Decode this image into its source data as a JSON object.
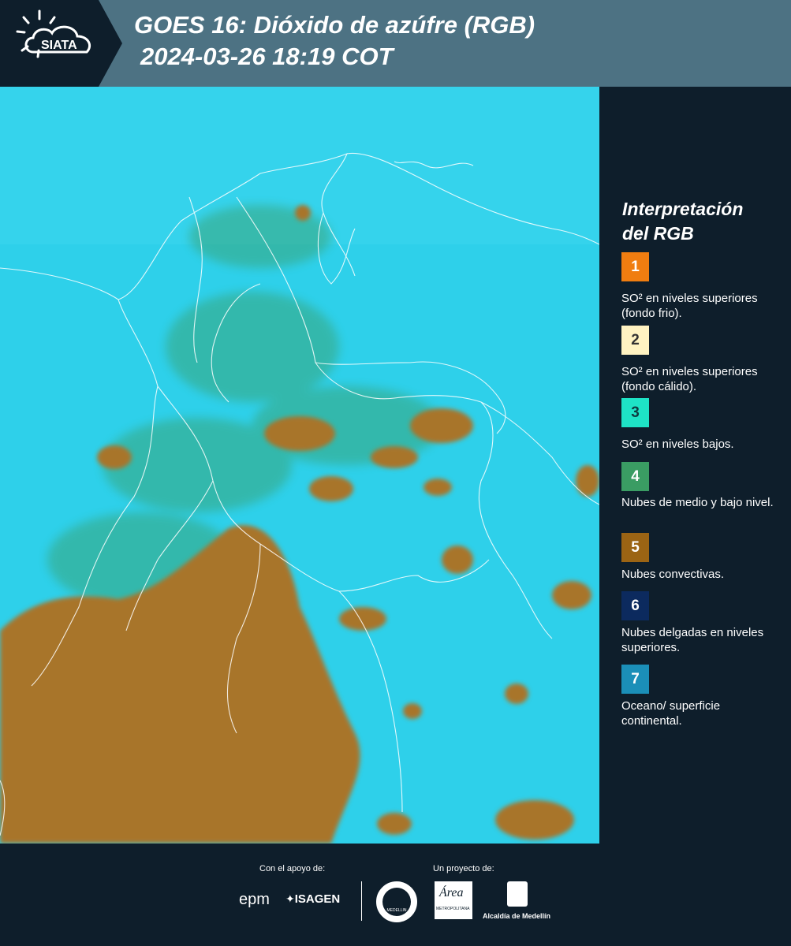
{
  "header": {
    "logo_text": "SIATA",
    "title_line1": "GOES 16: Dióxido de azúfre (RGB)",
    "title_line2": "2024-03-26 18:19 COT"
  },
  "legend": {
    "title_line1": "Interpretación",
    "title_line2": "del RGB",
    "items": [
      {
        "number": "1",
        "color": "#f07d10",
        "num_color": "#ffffff",
        "text": "SO² en niveles superiores (fondo frio)."
      },
      {
        "number": "2",
        "color": "#fff3c2",
        "num_color": "#333333",
        "text": "SO² en niveles superiores (fondo cálido)."
      },
      {
        "number": "3",
        "color": "#1ee3c6",
        "num_color": "#0e3a40",
        "text": "SO² en niveles bajos."
      },
      {
        "number": "4",
        "color": "#3a9c63",
        "num_color": "#ffffff",
        "text": "Nubes de medio y bajo nivel."
      },
      {
        "number": "5",
        "color": "#9b6414",
        "num_color": "#ffffff",
        "text": "Nubes convectivas."
      },
      {
        "number": "6",
        "color": "#0c2a5e",
        "num_color": "#ffffff",
        "text": "Nubes delgadas en niveles superiores."
      },
      {
        "number": "7",
        "color": "#1b8fb8",
        "num_color": "#ffffff",
        "text": "Oceano/ superficie continental."
      }
    ]
  },
  "footer": {
    "support_label": "Con el apoyo de:",
    "project_label": "Un proyecto de:",
    "epm_text": "epm",
    "isagen_text": "ISAGEN",
    "medellin_seal_text": "MEDELLIN",
    "area_text": "Área",
    "area_subtext": "METROPOLITANA",
    "alcaldia_text": "Alcaldía de Medellín"
  }
}
